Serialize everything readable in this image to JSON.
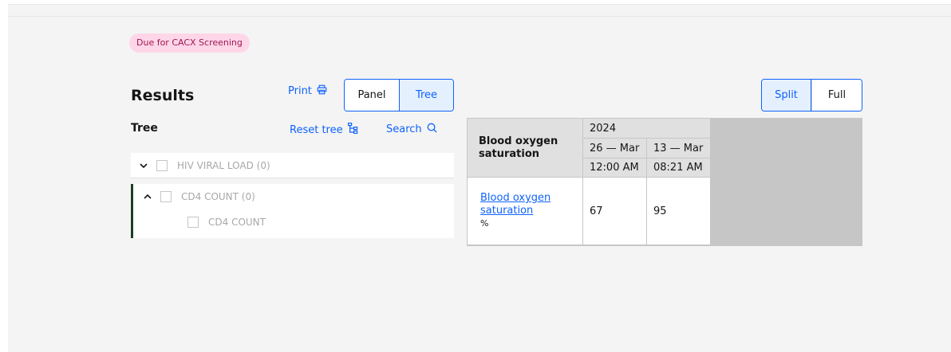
{
  "tag": {
    "label": "Due for CACX Screening"
  },
  "results": {
    "title": "Results",
    "print_label": "Print",
    "view_switch": [
      {
        "label": "Panel",
        "selected": false
      },
      {
        "label": "Tree",
        "selected": true
      }
    ],
    "layout_switch": [
      {
        "label": "Split",
        "selected": true
      },
      {
        "label": "Full",
        "selected": false
      }
    ]
  },
  "tree": {
    "heading": "Tree",
    "reset_label": "Reset tree",
    "search_label": "Search",
    "nodes": [
      {
        "label": "HIV VIRAL LOAD (0)",
        "expanded": false
      },
      {
        "label": "CD4 COUNT (0)",
        "expanded": true,
        "children": [
          {
            "label": "CD4 COUNT"
          }
        ]
      }
    ]
  },
  "table": {
    "header_label": "Blood oxygen saturation",
    "year": "2024",
    "columns": [
      {
        "date": "26 — Mar",
        "time": "12:00 AM"
      },
      {
        "date": "13 — Mar",
        "time": "08:21 AM"
      }
    ],
    "rows": [
      {
        "name": "Blood oxygen saturation",
        "unit": "%",
        "values": [
          "67",
          "95"
        ]
      }
    ]
  },
  "colors": {
    "accent": "#0f62fe",
    "tag_bg": "#ffd6e8",
    "tag_text": "#9f1853",
    "active_border": "#1b3f1f"
  }
}
